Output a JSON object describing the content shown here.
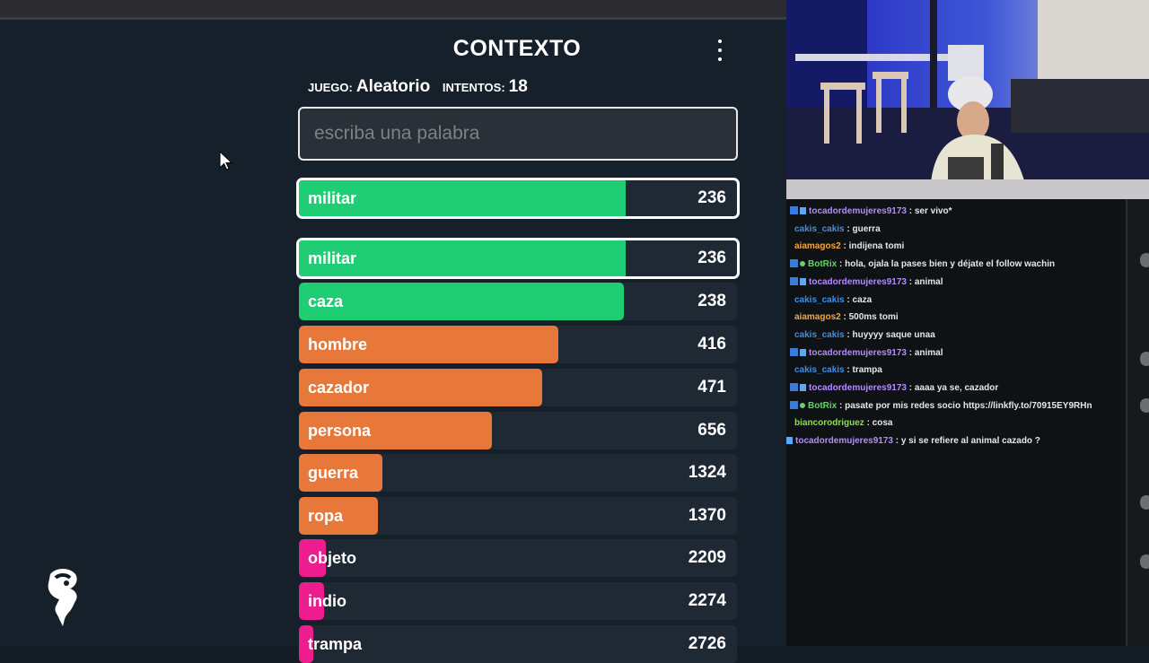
{
  "game": {
    "title": "CONTEXTO",
    "juego_label": "JUEGO:",
    "juego_value": "Aleatorio",
    "intentos_label": "INTENTOS:",
    "intentos_value": "18",
    "input_placeholder": "escriba una palabra",
    "last_guess": {
      "word": "militar",
      "rank": "236",
      "fill": 0.745,
      "color": "#1fce74"
    },
    "guesses": [
      {
        "word": "militar",
        "rank": "236",
        "fill": 0.745,
        "color": "#1fce74"
      },
      {
        "word": "caza",
        "rank": "238",
        "fill": 0.742,
        "color": "#1fce74"
      },
      {
        "word": "hombre",
        "rank": "416",
        "fill": 0.592,
        "color": "#e8773a"
      },
      {
        "word": "cazador",
        "rank": "471",
        "fill": 0.555,
        "color": "#e8773a"
      },
      {
        "word": "persona",
        "rank": "656",
        "fill": 0.441,
        "color": "#e8773a"
      },
      {
        "word": "guerra",
        "rank": "1324",
        "fill": 0.191,
        "color": "#e8773a"
      },
      {
        "word": "ropa",
        "rank": "1370",
        "fill": 0.181,
        "color": "#e8773a"
      },
      {
        "word": "objeto",
        "rank": "2209",
        "fill": 0.062,
        "color": "#ee1d8f"
      },
      {
        "word": "indio",
        "rank": "2274",
        "fill": 0.058,
        "color": "#ee1d8f"
      },
      {
        "word": "trampa",
        "rank": "2726",
        "fill": 0.032,
        "color": "#ee1d8f"
      }
    ]
  },
  "chat": {
    "messages": [
      {
        "user": "tocadordemujeres9173",
        "text": ": ser vivo*",
        "color": "#b38bff",
        "badges": "sub"
      },
      {
        "user": "cakis_cakis",
        "text": ": guerra",
        "color": "#3d8fe6",
        "badges": ""
      },
      {
        "user": "aiamagos2",
        "text": ": indijena tomi",
        "color": "#f5a742",
        "badges": ""
      },
      {
        "user": "BotRix",
        "text": ": hola, ojala la pases bien y déjate el follow wachin",
        "color": "#6ad06a",
        "badges": "bot"
      },
      {
        "user": "tocadordemujeres9173",
        "text": ": animal",
        "color": "#b38bff",
        "badges": "sub"
      },
      {
        "user": "cakis_cakis",
        "text": ": caza",
        "color": "#3d8fe6",
        "badges": ""
      },
      {
        "user": "aiamagos2",
        "text": ": 500ms tomi",
        "color": "#f5a742",
        "badges": ""
      },
      {
        "user": "cakis_cakis",
        "text": ": huyyyy saque unaa",
        "color": "#3d8fe6",
        "badges": ""
      },
      {
        "user": "tocadordemujeres9173",
        "text": ": animal",
        "color": "#b38bff",
        "badges": "sub"
      },
      {
        "user": "cakis_cakis",
        "text": ": trampa",
        "color": "#3d8fe6",
        "badges": ""
      },
      {
        "user": "tocadordemujeres9173",
        "text": ": aaaa ya se, cazador",
        "color": "#b38bff",
        "badges": "sub"
      },
      {
        "user": "BotRix",
        "text": ": pasate por mis redes socio https://linkfly.to/70915EY9RHn",
        "color": "#6ad06a",
        "badges": "bot"
      },
      {
        "user": "biancorodriguez",
        "text": ": cosa",
        "color": "#8be04e",
        "badges": ""
      },
      {
        "user": "tocadordemujeres9173",
        "text": ": y si se refiere al animal cazado ?",
        "color": "#b38bff",
        "badges": "sub-cut"
      }
    ]
  }
}
